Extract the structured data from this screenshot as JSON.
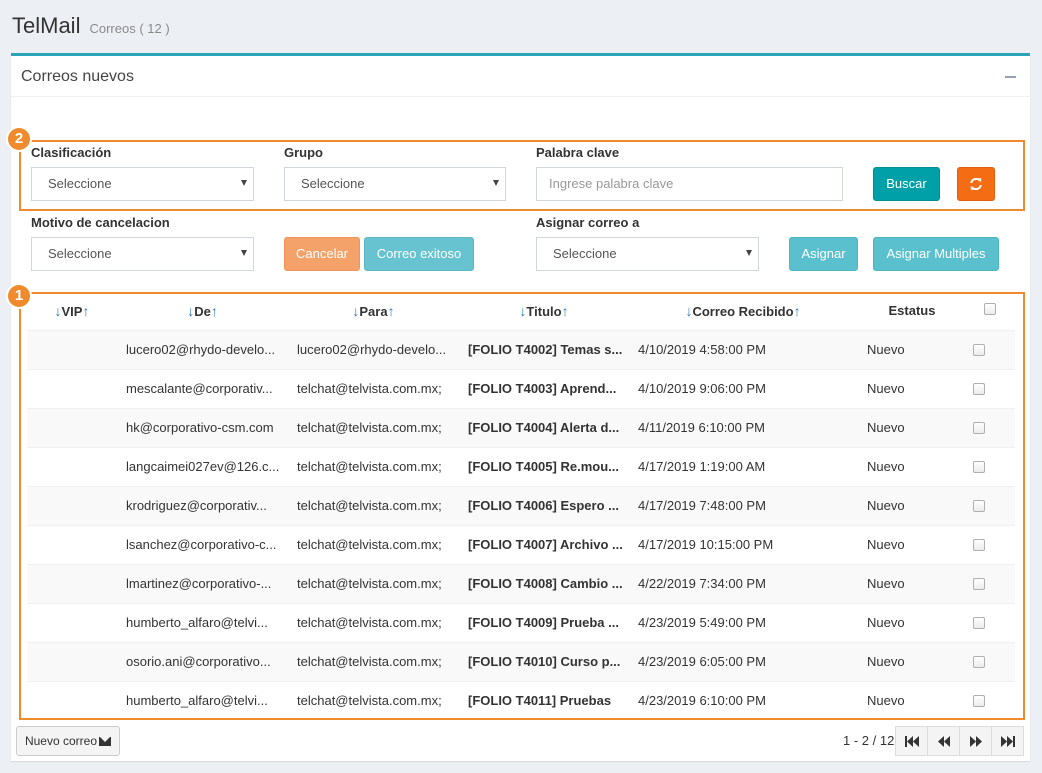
{
  "app": {
    "title": "TelMail",
    "subtitle": "Correos ( 12 )"
  },
  "panel": {
    "title": "Correos nuevos",
    "collapse_icon": "minus-icon"
  },
  "annotations": {
    "table_marker": "1",
    "filters_marker": "2",
    "color": "#ef8b2c"
  },
  "filters": {
    "clasificacion": {
      "label": "Clasificación",
      "value": "Seleccione"
    },
    "grupo": {
      "label": "Grupo",
      "value": "Seleccione"
    },
    "palabra_clave": {
      "label": "Palabra clave",
      "placeholder": "Ingrese palabra clave"
    },
    "buscar_label": "Buscar",
    "refresh_icon": "refresh-icon",
    "motivo": {
      "label": "Motivo de cancelacion",
      "value": "Seleccione"
    },
    "cancelar_label": "Cancelar",
    "correo_exitoso_label": "Correo exitoso",
    "asignar_a": {
      "label": "Asignar correo a",
      "value": "Seleccione"
    },
    "asignar_label": "Asignar",
    "asignar_multiples_label": "Asignar Multiples"
  },
  "table": {
    "headers": {
      "vip": "VIP",
      "de": "De",
      "para": "Para",
      "titulo": "Titulo",
      "recibido": "Correo Recibido",
      "estatus": "Estatus"
    },
    "rows": [
      {
        "de": "lucero02@rhydo-develo...",
        "para": "lucero02@rhydo-develo...",
        "titulo": "[FOLIO T4002] Temas s...",
        "recibido": "4/10/2019 4:58:00 PM",
        "estatus": "Nuevo"
      },
      {
        "de": "mescalante@corporativ...",
        "para": "telchat@telvista.com.mx;",
        "titulo": "[FOLIO T4003] Aprend...",
        "recibido": "4/10/2019 9:06:00 PM",
        "estatus": "Nuevo"
      },
      {
        "de": "hk@corporativo-csm.com",
        "para": "telchat@telvista.com.mx;",
        "titulo": "[FOLIO T4004] Alerta d...",
        "recibido": "4/11/2019 6:10:00 PM",
        "estatus": "Nuevo"
      },
      {
        "de": "langcaimei027ev@126.c...",
        "para": "telchat@telvista.com.mx;",
        "titulo": "[FOLIO T4005] Re.mou...",
        "recibido": "4/17/2019 1:19:00 AM",
        "estatus": "Nuevo"
      },
      {
        "de": "krodriguez@corporativ...",
        "para": "telchat@telvista.com.mx;",
        "titulo": "[FOLIO T4006] Espero ...",
        "recibido": "4/17/2019 7:48:00 PM",
        "estatus": "Nuevo"
      },
      {
        "de": "lsanchez@corporativo-c...",
        "para": "telchat@telvista.com.mx;",
        "titulo": "[FOLIO T4007] Archivo ...",
        "recibido": "4/17/2019 10:15:00 PM",
        "estatus": "Nuevo"
      },
      {
        "de": "lmartinez@corporativo-...",
        "para": "telchat@telvista.com.mx;",
        "titulo": "[FOLIO T4008] Cambio ...",
        "recibido": "4/22/2019 7:34:00 PM",
        "estatus": "Nuevo"
      },
      {
        "de": "humberto_alfaro@telvi...",
        "para": "telchat@telvista.com.mx;",
        "titulo": "[FOLIO T4009] Prueba ...",
        "recibido": "4/23/2019 5:49:00 PM",
        "estatus": "Nuevo"
      },
      {
        "de": "osorio.ani@corporativo...",
        "para": "telchat@telvista.com.mx;",
        "titulo": "[FOLIO T4010] Curso p...",
        "recibido": "4/23/2019 6:05:00 PM",
        "estatus": "Nuevo"
      },
      {
        "de": "humberto_alfaro@telvi...",
        "para": "telchat@telvista.com.mx;",
        "titulo": "[FOLIO T4011] Pruebas",
        "recibido": "4/23/2019 6:10:00 PM",
        "estatus": "Nuevo"
      }
    ]
  },
  "footer": {
    "nuevo_correo_label": "Nuevo correo",
    "pagination": "1 - 2 / 12",
    "pager_icons": [
      "first-page-icon",
      "previous-page-icon",
      "next-page-icon",
      "last-page-icon"
    ]
  }
}
